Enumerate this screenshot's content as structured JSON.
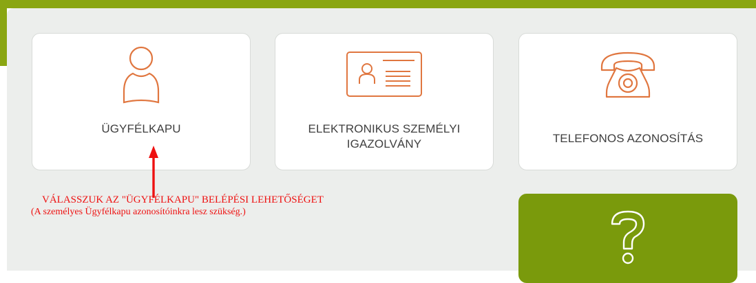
{
  "login_options": [
    {
      "label": "ÜGYFÉLKAPU",
      "icon": "person-icon"
    },
    {
      "label": "ELEKTRONIKUS SZEMÉLYI IGAZOLVÁNY",
      "icon": "id-card-icon"
    },
    {
      "label": "TELEFONOS AZONOSÍTÁS",
      "icon": "telephone-icon"
    }
  ],
  "annotation": {
    "line1": "VÁLASSZUK AZ \"ÜGYFÉLKAPU\" BELÉPÉSI LEHETŐSÉGET",
    "line2": "(A személyes Ügyfélkapu azonosítóinkra lesz szükség.)",
    "color": "#ee1111"
  },
  "help": {
    "icon": "question-mark-icon"
  },
  "colors": {
    "accent": "#e0763f",
    "brand_green": "#8aa612",
    "help_green": "#7a9a0c"
  }
}
